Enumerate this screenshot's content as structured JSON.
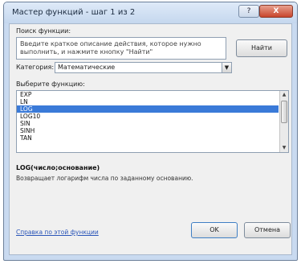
{
  "window": {
    "title": "Мастер функций - шаг 1 из 2",
    "help_label": "?",
    "close_label": "X"
  },
  "search": {
    "label": "Поиск функции:",
    "text": "Введите краткое описание действия, которое нужно выполнить, и нажмите кнопку \"Найти\"",
    "find_label": "Найти"
  },
  "category": {
    "label": "Категория:",
    "value": "Математические"
  },
  "functions": {
    "label": "Выберите функцию:",
    "items": [
      "EXP",
      "LN",
      "LOG",
      "LOG10",
      "SIN",
      "SINH",
      "TAN"
    ],
    "selected_index": 2
  },
  "syntax": "LOG(число;основание)",
  "description": "Возвращает логарифм числа по заданному основанию.",
  "footer": {
    "help_link": "Справка по этой функции",
    "ok_label": "OK",
    "cancel_label": "Отмена"
  }
}
